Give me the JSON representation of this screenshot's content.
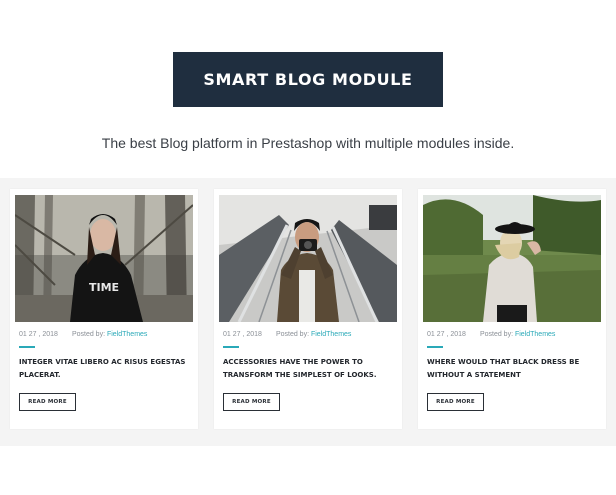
{
  "header": {
    "title": "SMART BLOG MODULE",
    "subtitle": "The best Blog platform in Prestashop with multiple modules inside."
  },
  "colors": {
    "title_bg": "#1f2e3f",
    "accent": "#2aa9b8",
    "band_bg": "#f4f4f4"
  },
  "posts": [
    {
      "date": "01 27 , 2018",
      "posted_by": "Posted by:",
      "author": "FieldThemes",
      "title": "INTEGER VITAE LIBERO AC RISUS EGESTAS PLACERAT.",
      "button": "READ MORE",
      "image": "woman-in-black-hoodie-forest-photo"
    },
    {
      "date": "01 27 , 2018",
      "posted_by": "Posted by:",
      "author": "FieldThemes",
      "title": "ACCESSORIES HAVE THE POWER TO TRANSFORM THE SIMPLEST OF LOOKS.",
      "button": "READ MORE",
      "image": "man-with-camera-escalator-photo"
    },
    {
      "date": "01 27 , 2018",
      "posted_by": "Posted by:",
      "author": "FieldThemes",
      "title": "WHERE WOULD THAT BLACK DRESS BE WITHOUT A STATEMENT",
      "button": "READ MORE",
      "image": "woman-in-hat-field-photo"
    }
  ]
}
